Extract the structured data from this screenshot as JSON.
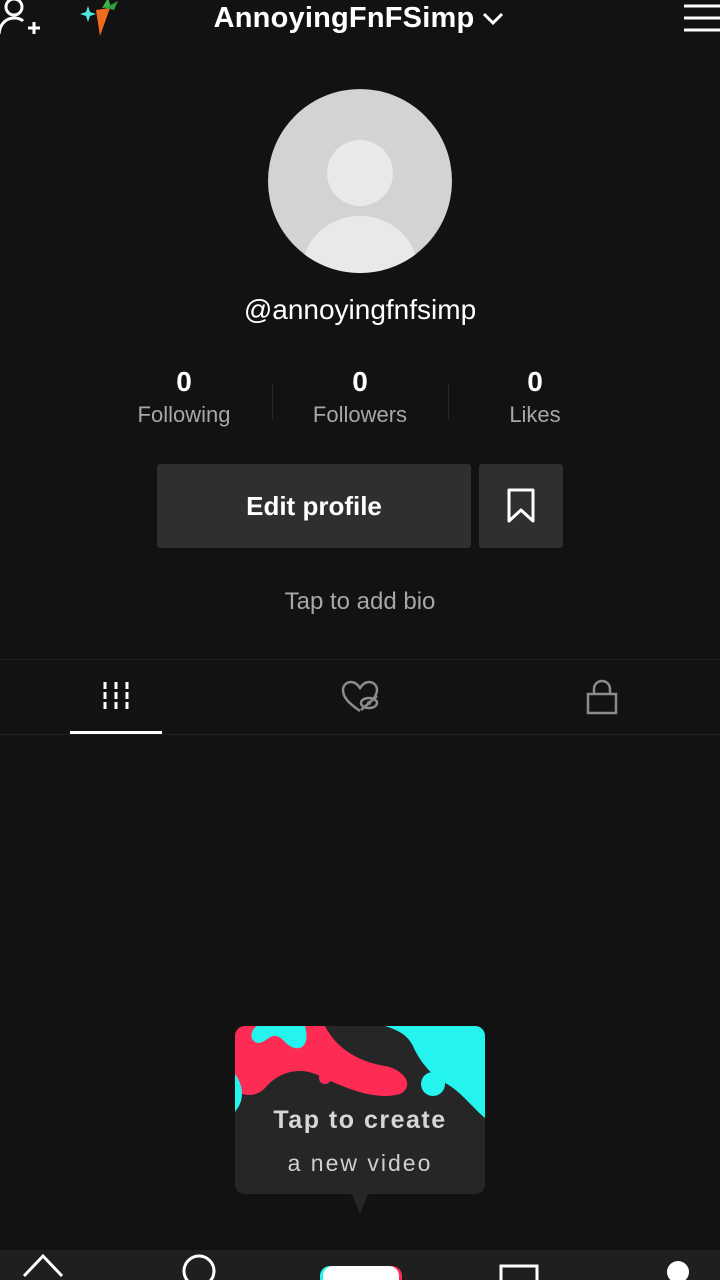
{
  "header": {
    "username": "AnnoyingFnFSimp",
    "icons": {
      "left": "add-user-icon",
      "badge": "carrot-icon",
      "switch": "chevron-down-icon",
      "right": "menu-icon"
    }
  },
  "profile": {
    "handle": "@annoyingfnfsimp",
    "stats": [
      {
        "value": "0",
        "label": "Following"
      },
      {
        "value": "0",
        "label": "Followers"
      },
      {
        "value": "0",
        "label": "Likes"
      }
    ],
    "edit_label": "Edit profile",
    "bio_placeholder": "Tap to add bio"
  },
  "tabs": {
    "items": [
      "videos-grid-icon",
      "liked-hidden-icon",
      "private-lock-icon"
    ],
    "active_index": 0
  },
  "create_popup": {
    "line1": "Tap to create",
    "line2": "a new video"
  },
  "colors": {
    "background": "#121212",
    "button": "#2f2f2f",
    "muted_text": "#a7a7a7",
    "accent_red": "#fe2c55",
    "accent_cyan": "#25f4ee"
  }
}
